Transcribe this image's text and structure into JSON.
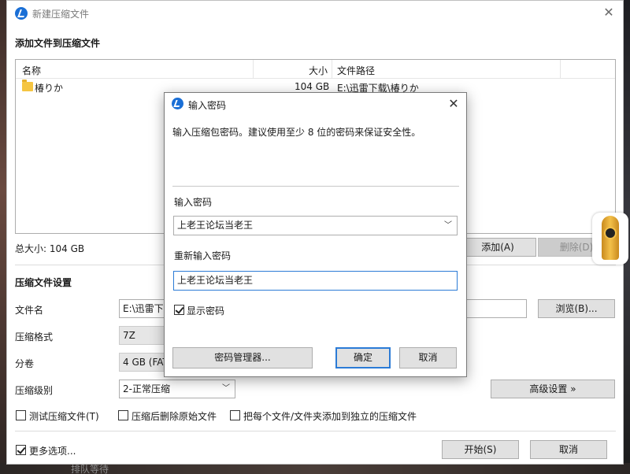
{
  "main_window": {
    "title": "新建压缩文件",
    "section_add": "添加文件到压缩文件",
    "file_list": {
      "columns": [
        "名称",
        "大小",
        "文件路径"
      ],
      "rows": [
        {
          "name": "椿りか",
          "size": "104 GB",
          "path": "E:\\迅雷下载\\椿りか"
        }
      ]
    },
    "total_size": "总大小: 104 GB",
    "add_button": "添加(A)",
    "delete_button": "删除(D)",
    "section_settings": "压缩文件设置",
    "filename_label": "文件名",
    "filename_value": "E:\\迅雷下载",
    "browse_button": "浏览(B)...",
    "format_label": "压缩格式",
    "format_value": "7Z",
    "split_label": "分卷",
    "split_value": "4 GB (FAT",
    "level_label": "压缩级别",
    "level_value": "2-正常压缩",
    "advanced_button": "高级设置 »",
    "options": {
      "test_archive": "测试压缩文件(T)",
      "delete_source": "压缩后删除原始文件",
      "each_separate": "把每个文件/文件夹添加到独立的压缩文件",
      "more_options": "更多选项..."
    },
    "start_button": "开始(S)",
    "cancel_button": "取消"
  },
  "password_dialog": {
    "title": "输入密码",
    "description": "输入压缩包密码。建议使用至少 8 位的密码来保证安全性。",
    "password_label": "输入密码",
    "password_value": "上老王论坛当老王",
    "confirm_label": "重新输入密码",
    "confirm_value": "上老王论坛当老王",
    "show_password_label": "显示密码",
    "show_password_checked": true,
    "manager_button": "密码管理器...",
    "ok_button": "确定",
    "cancel_button": "取消"
  },
  "background": {
    "bottom_text": "排队等待"
  },
  "colors": {
    "accent": "#2b7bd6",
    "logo": "#1a6fd6",
    "folder": "#f5c542"
  }
}
